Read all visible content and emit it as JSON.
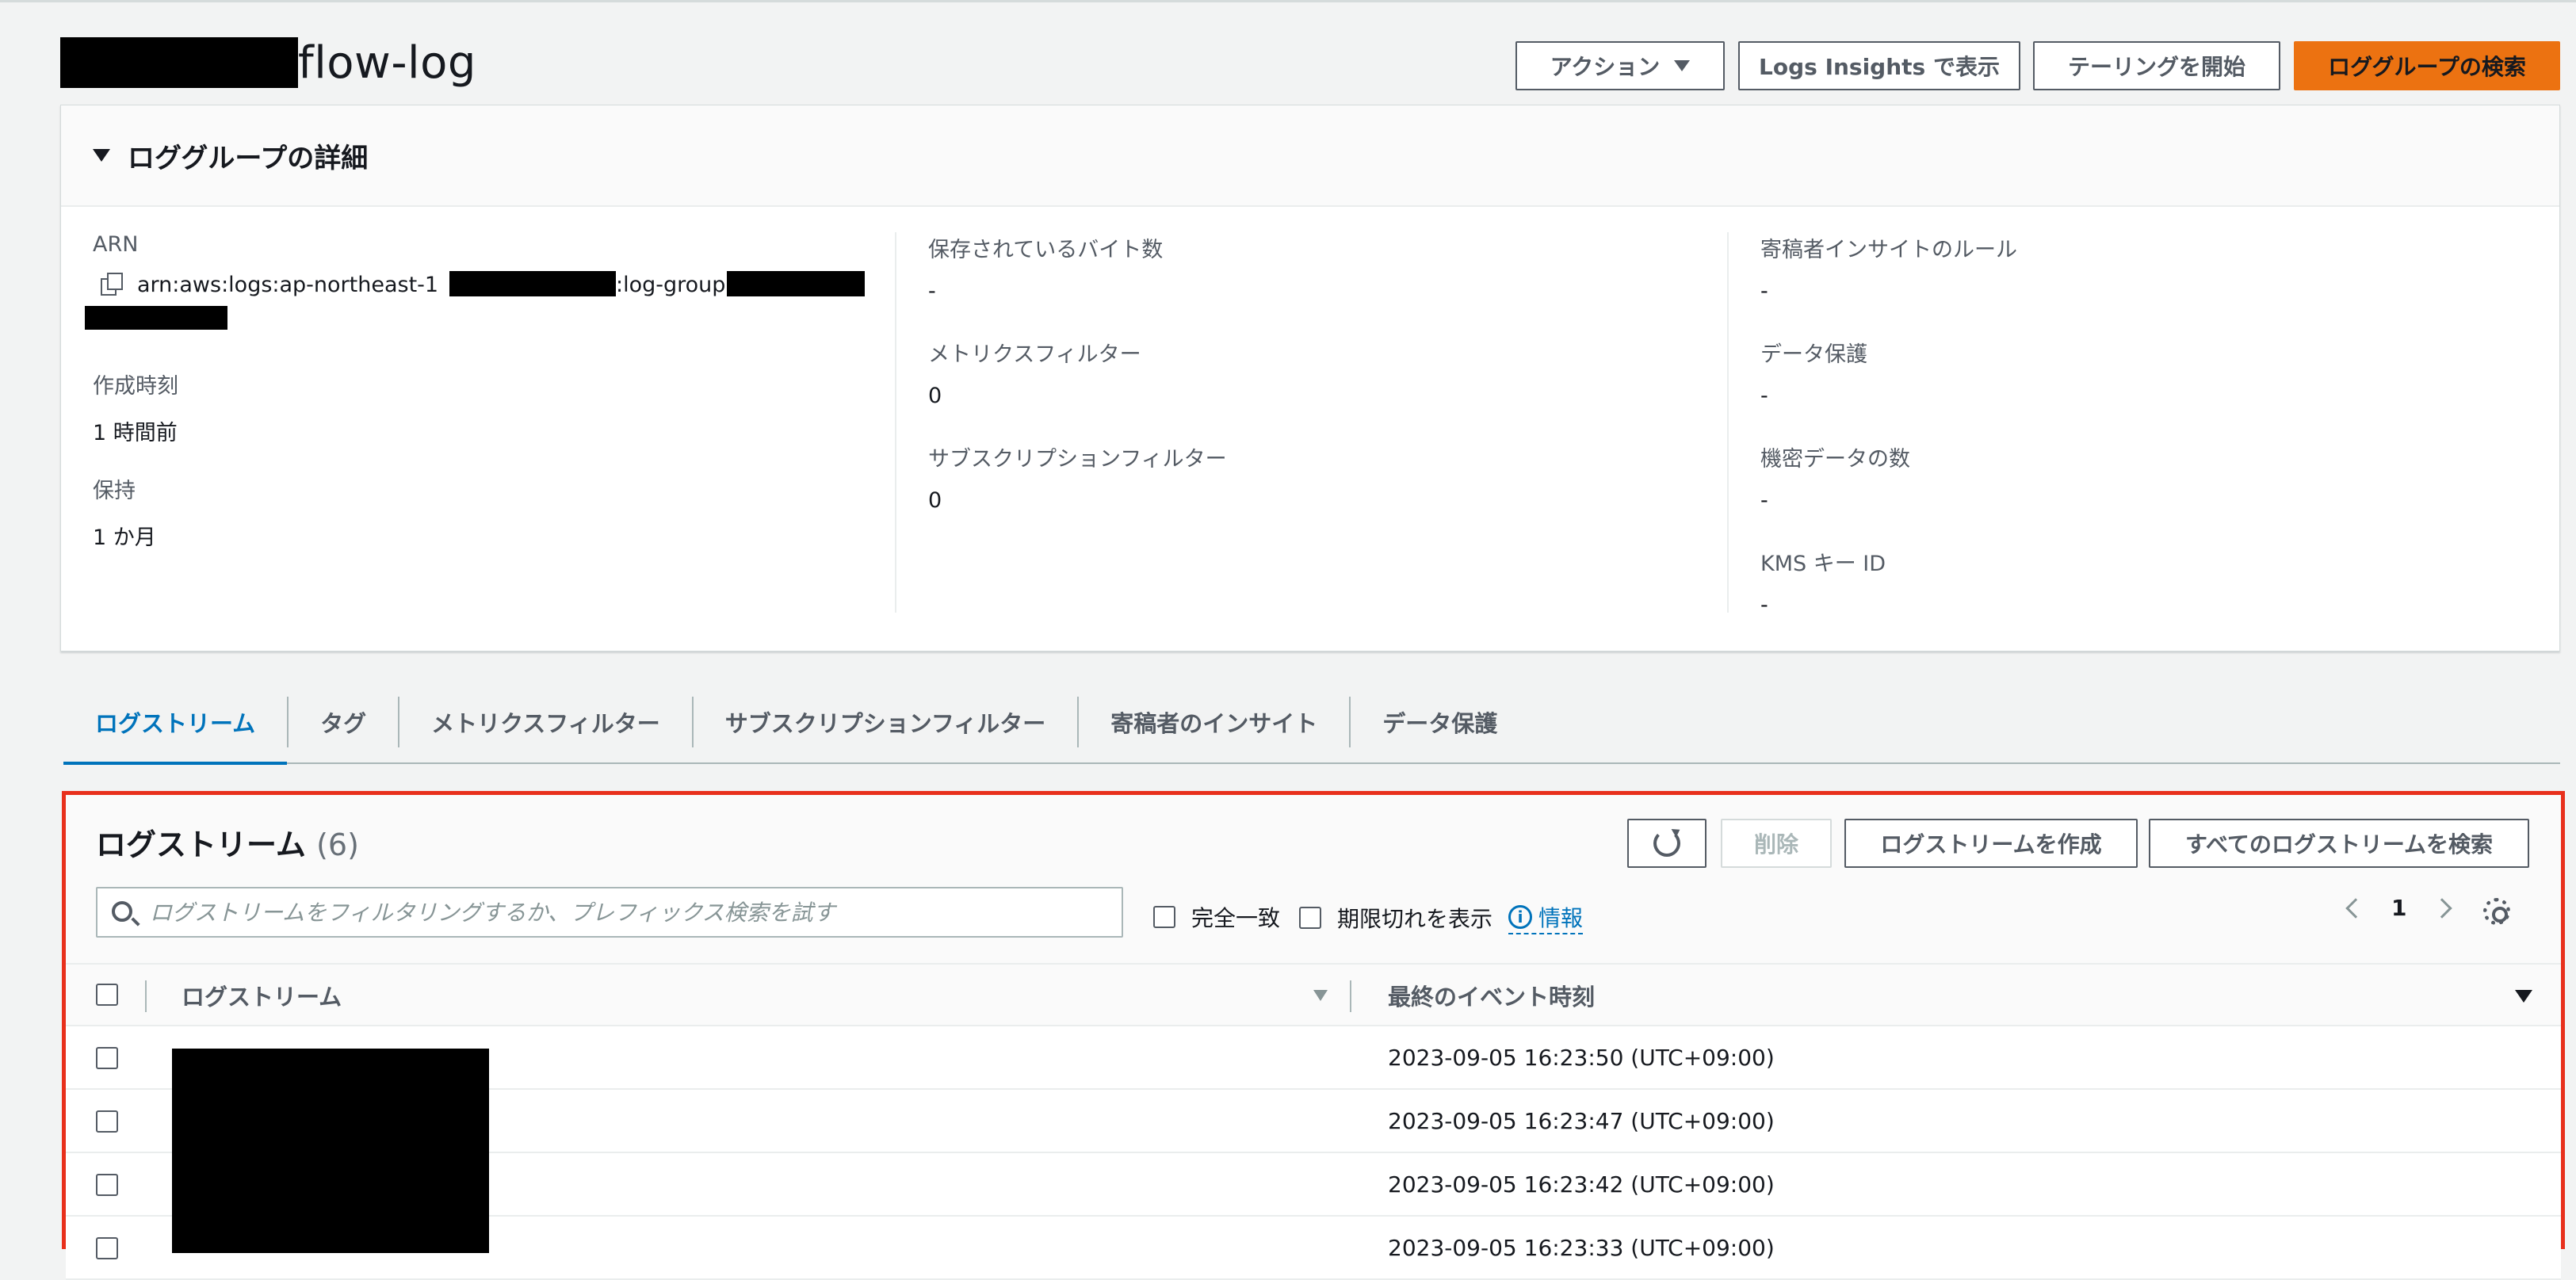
{
  "header": {
    "title_suffix": "flow-log",
    "buttons": {
      "actions": "アクション",
      "logs_insights": "Logs Insights で表示",
      "tailing": "テーリングを開始",
      "search_group": "ロググループの検索"
    }
  },
  "details": {
    "title": "ロググループの詳細",
    "arn_label": "ARN",
    "arn_prefix": "arn:aws:logs:ap-northeast-1",
    "arn_mid": ":log-group:",
    "created_label": "作成時刻",
    "created_value": "1 時間前",
    "retention_label": "保持",
    "retention_value": "1 か月",
    "stored_bytes_label": "保存されているバイト数",
    "stored_bytes_value": "-",
    "metric_filter_label": "メトリクスフィルター",
    "metric_filter_value": "0",
    "subscription_filter_label": "サブスクリプションフィルター",
    "subscription_filter_value": "0",
    "contributor_rules_label": "寄稿者インサイトのルール",
    "contributor_rules_value": "-",
    "data_protection_label": "データ保護",
    "data_protection_value": "-",
    "sensitive_count_label": "機密データの数",
    "sensitive_count_value": "-",
    "kms_label": "KMS キー ID",
    "kms_value": "-"
  },
  "tabs": [
    {
      "label": "ログストリーム",
      "active": true
    },
    {
      "label": "タグ"
    },
    {
      "label": "メトリクスフィルター"
    },
    {
      "label": "サブスクリプションフィルター"
    },
    {
      "label": "寄稿者のインサイト"
    },
    {
      "label": "データ保護"
    }
  ],
  "streams": {
    "title": "ログストリーム",
    "count": "(6)",
    "delete_label": "削除",
    "create_label": "ログストリームを作成",
    "search_all_label": "すべてのログストリームを検索",
    "search_placeholder": "ログストリームをフィルタリングするか、プレフィックス検索を試す",
    "exact_match": "完全一致",
    "show_expired": "期限切れを表示",
    "info": "情報",
    "page": "1",
    "col_stream": "ログストリーム",
    "col_last_event": "最終のイベント時刻",
    "rows": [
      {
        "time": "2023-09-05 16:23:50 (UTC+09:00)"
      },
      {
        "time": "2023-09-05 16:23:47 (UTC+09:00)"
      },
      {
        "time": "2023-09-05 16:23:42 (UTC+09:00)"
      },
      {
        "time": "2023-09-05 16:23:33 (UTC+09:00)"
      }
    ]
  },
  "colors": {
    "primary": "#ec7211",
    "link": "#0073bb",
    "highlight": "#e8301c"
  }
}
